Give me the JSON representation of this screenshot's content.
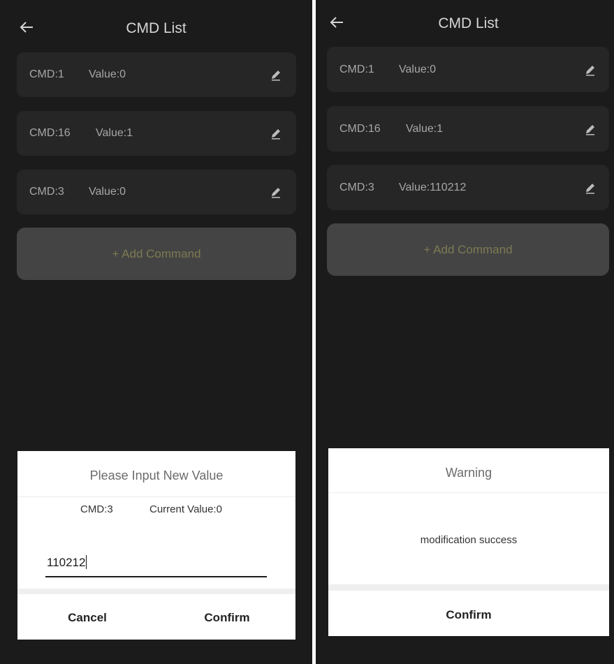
{
  "left_screen": {
    "header": {
      "title": "CMD List"
    },
    "commands": [
      {
        "cmd": "CMD:1",
        "value": "Value:0"
      },
      {
        "cmd": "CMD:16",
        "value": "Value:1"
      },
      {
        "cmd": "CMD:3",
        "value": "Value:0"
      }
    ],
    "add_button_label": "+ Add Command",
    "dialog": {
      "title": "Please Input New Value",
      "cmd_text": "CMD:3",
      "current_value_text": "Current Value:0",
      "input_value": "110212",
      "cancel_label": "Cancel",
      "confirm_label": "Confirm"
    }
  },
  "right_screen": {
    "header": {
      "title": "CMD List"
    },
    "commands": [
      {
        "cmd": "CMD:1",
        "value": "Value:0"
      },
      {
        "cmd": "CMD:16",
        "value": "Value:1"
      },
      {
        "cmd": "CMD:3",
        "value": "Value:110212"
      }
    ],
    "add_button_label": "+ Add Command",
    "dialog": {
      "title": "Warning",
      "message": "modification success",
      "confirm_label": "Confirm"
    }
  },
  "colors": {
    "background": "#1b1b1b",
    "card": "#262626",
    "add_button": "#444444",
    "add_text": "#7d7a52"
  },
  "icons": [
    "back-arrow-icon",
    "edit-pencil-icon"
  ]
}
